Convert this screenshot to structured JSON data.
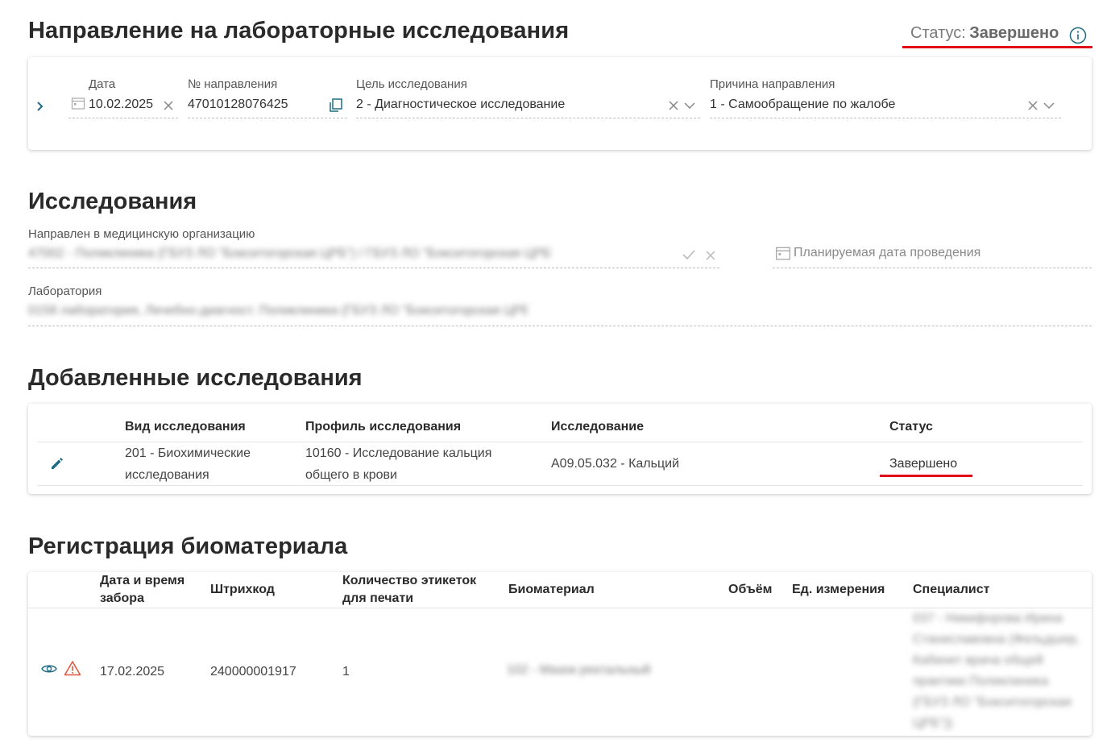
{
  "header": {
    "title": "Направление на лабораторные исследования",
    "status_label": "Статус:",
    "status_value": "Завершено"
  },
  "referral": {
    "date_label": "Дата",
    "date_value": "10.02.2025",
    "number_label": "№ направления",
    "number_value": "47010128076425",
    "purpose_label": "Цель исследования",
    "purpose_value": "2 - Диагностическое исследование",
    "reason_label": "Причина направления",
    "reason_value": "1 - Самообращение по жалобе"
  },
  "studies": {
    "title": "Исследования",
    "org_label": "Направлен в медицинскую организацию",
    "org_value": "47002 - Поликлиника (ГБУЗ ЛО \"Бокситогорская ЦРБ\") / ГБУЗ ЛО \"Бокситогорская ЦРБ\" ПОЛ",
    "planned_date_placeholder": "Планируемая дата проведения",
    "lab_label": "Лаборатория",
    "lab_value": "0158 лаборатория, Лечебно-диагност. Поликлиника (ГБУЗ ЛО \"Бокситогорская ЦРБ\")"
  },
  "added_studies": {
    "title": "Добавленные исследования",
    "columns": [
      "Вид исследования",
      "Профиль исследования",
      "Исследование",
      "Статус"
    ],
    "rows": [
      {
        "type": "201 - Биохимические исследования",
        "profile": "10160 - Исследование кальция общего в крови",
        "study": "A09.05.032 - Кальций",
        "status": "Завершено"
      }
    ]
  },
  "biomaterial": {
    "title": "Регистрация биоматериала",
    "columns": [
      "Дата и время забора",
      "Штрихкод",
      "Количество этикеток для печати",
      "Биоматериал",
      "Объём",
      "Ед. измерения",
      "Специалист"
    ],
    "rows": [
      {
        "date": "17.02.2025",
        "barcode": "240000001917",
        "label_count": "1",
        "material": "102 - Мазок ректальный",
        "volume": "",
        "unit": "",
        "specialist": "037 - Никифорова Ирина Станиславовна (Фельдшер, Кабинет врача общей практики Поликлиника (ГБУЗ ЛО \"Бокситогорская ЦРБ\"))"
      }
    ]
  },
  "colors": {
    "accent": "#1f6b85",
    "underline_red": "#e0001a",
    "warning": "#e0543a"
  }
}
